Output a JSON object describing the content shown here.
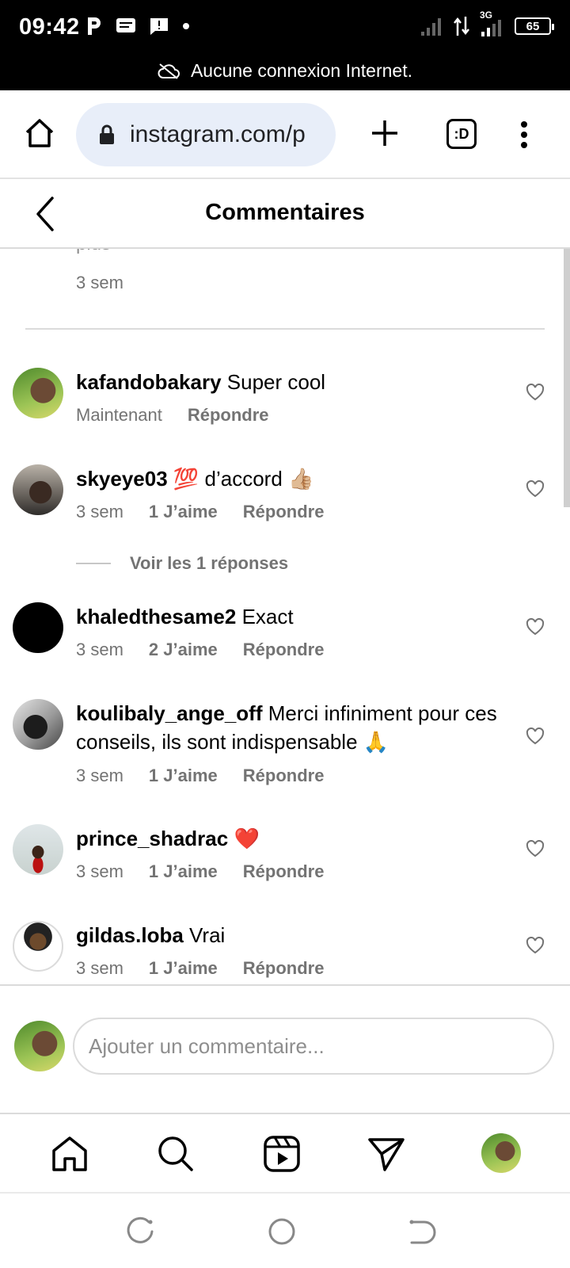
{
  "status_bar": {
    "time": "09:42",
    "battery": "65",
    "network": "3G",
    "offline_message": "Aucune connexion Internet."
  },
  "browser": {
    "url": "instagram.com/p",
    "tab_badge": ":D"
  },
  "header": {
    "title": "Commentaires"
  },
  "previous_comment": {
    "text_fragment": "plus",
    "time": "3 sem"
  },
  "comments": [
    {
      "username": "kafandobakary",
      "text": "Super cool",
      "time": "Maintenant",
      "likes": "",
      "reply": "Répondre"
    },
    {
      "username": "skyeye03",
      "text": "💯 d’accord 👍🏼",
      "time": "3 sem",
      "likes": "1 J’aime",
      "reply": "Répondre"
    },
    {
      "username": "khaledthesame2",
      "text": "Exact",
      "time": "3 sem",
      "likes": "2 J’aime",
      "reply": "Répondre"
    },
    {
      "username": "koulibaly_ange_off",
      "text": "Merci infiniment pour ces conseils, ils sont indispensable 🙏",
      "time": "3 sem",
      "likes": "1 J’aime",
      "reply": "Répondre"
    },
    {
      "username": "prince_shadrac",
      "text": "❤️",
      "time": "3 sem",
      "likes": "1 J’aime",
      "reply": "Répondre"
    },
    {
      "username": "gildas.loba",
      "text": "Vrai",
      "time": "3 sem",
      "likes": "1 J’aime",
      "reply": "Répondre"
    }
  ],
  "view_replies": "Voir les 1 réponses",
  "add_comment": {
    "placeholder": "Ajouter un commentaire..."
  },
  "colors": {
    "meta_gray": "#737373",
    "url_bg": "#e8eef9",
    "divider": "#dbdbdb"
  }
}
